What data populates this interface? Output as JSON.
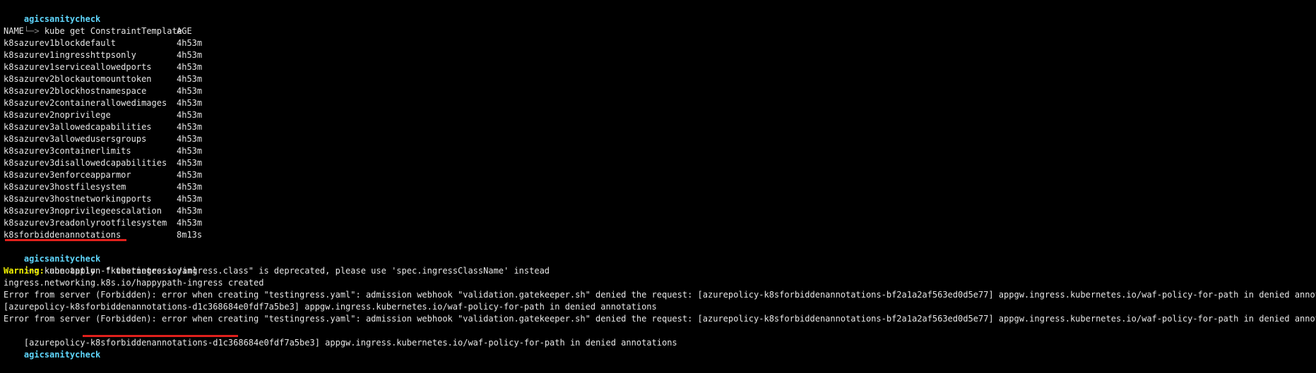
{
  "terminal": {
    "prompt_host": "agicsanitycheck",
    "prompt_arrow": "└─>",
    "commands": {
      "get_templates": "kube get ConstraintTemplate",
      "apply": "kube apply -f testingress.yaml"
    },
    "table": {
      "headers": {
        "name": "NAME",
        "age": "AGE"
      },
      "rows": [
        {
          "name": "k8sazurev1blockdefault",
          "age": "4h53m"
        },
        {
          "name": "k8sazurev1ingresshttpsonly",
          "age": "4h53m"
        },
        {
          "name": "k8sazurev1serviceallowedports",
          "age": "4h53m"
        },
        {
          "name": "k8sazurev2blockautomounttoken",
          "age": "4h53m"
        },
        {
          "name": "k8sazurev2blockhostnamespace",
          "age": "4h53m"
        },
        {
          "name": "k8sazurev2containerallowedimages",
          "age": "4h53m"
        },
        {
          "name": "k8sazurev2noprivilege",
          "age": "4h53m"
        },
        {
          "name": "k8sazurev3allowedcapabilities",
          "age": "4h53m"
        },
        {
          "name": "k8sazurev3allowedusersgroups",
          "age": "4h53m"
        },
        {
          "name": "k8sazurev3containerlimits",
          "age": "4h53m"
        },
        {
          "name": "k8sazurev3disallowedcapabilities",
          "age": "4h53m"
        },
        {
          "name": "k8sazurev3enforceapparmor",
          "age": "4h53m"
        },
        {
          "name": "k8sazurev3hostfilesystem",
          "age": "4h53m"
        },
        {
          "name": "k8sazurev3hostnetworkingports",
          "age": "4h53m"
        },
        {
          "name": "k8sazurev3noprivilegeescalation",
          "age": "4h53m"
        },
        {
          "name": "k8sazurev3readonlyrootfilesystem",
          "age": "4h53m"
        },
        {
          "name": "k8sforbiddenannotations",
          "age": "8m13s"
        }
      ]
    },
    "output": {
      "warning_label": "Warning:",
      "warning_text": " annotation \"kubernetes.io/ingress.class\" is deprecated, please use 'spec.ingressClassName' instead",
      "created": "ingress.networking.k8s.io/happypath-ingress created",
      "error1_line1": "Error from server (Forbidden): error when creating \"testingress.yaml\": admission webhook \"validation.gatekeeper.sh\" denied the request: [azurepolicy-k8sforbiddenannotations-bf2a1a2af563ed0d5e77] appgw.ingress.kubernetes.io/waf-policy-for-path in denied annotations",
      "error1_line2": "[azurepolicy-k8sforbiddenannotations-d1c368684e0fdf7a5be3] appgw.ingress.kubernetes.io/waf-policy-for-path in denied annotations",
      "error2_line1": "Error from server (Forbidden): error when creating \"testingress.yaml\": admission webhook \"validation.gatekeeper.sh\" denied the request: [azurepolicy-k8sforbiddenannotations-bf2a1a2af563ed0d5e77] appgw.ingress.kubernetes.io/waf-policy-for-path in denied annotations",
      "error2_line2": "[azurepolicy-k8sforbiddenannotations-d1c368684e0fdf7a5be3] appgw.ingress.kubernetes.io/waf-policy-for-path in denied annotations"
    },
    "colors": {
      "background": "#000000",
      "text": "#e6e6e6",
      "prompt_host": "#5fd7ff",
      "warning": "#f2f200",
      "annotation_underline": "#e0201c"
    }
  }
}
